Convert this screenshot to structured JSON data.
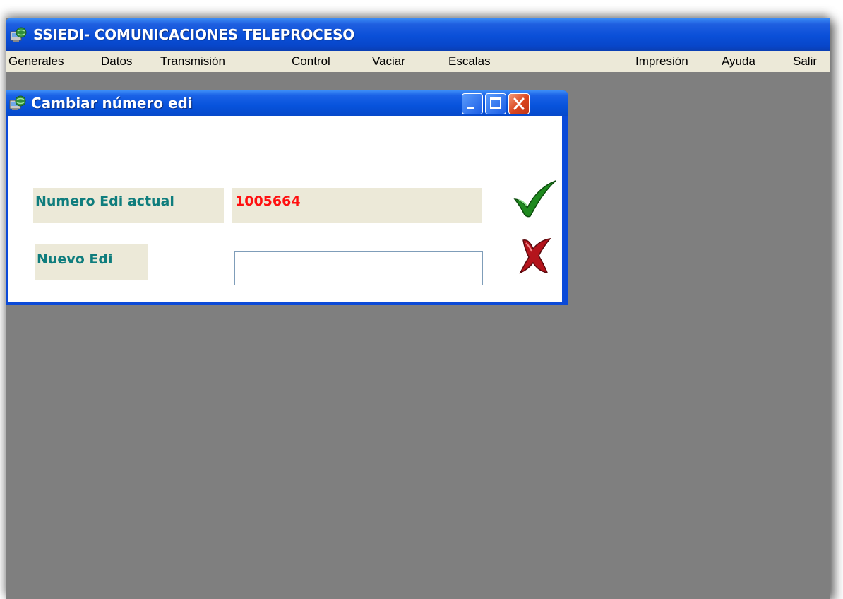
{
  "app": {
    "title": "SSIEDI- COMUNICACIONES TELEPROCESO",
    "icon": "app-icon"
  },
  "menu": {
    "items": [
      {
        "label": "Generales"
      },
      {
        "label": "Datos"
      },
      {
        "label": "Transmisión"
      },
      {
        "label": "Control"
      },
      {
        "label": "Vaciar"
      },
      {
        "label": "Escalas"
      },
      {
        "label": "Impresión"
      },
      {
        "label": "Ayuda"
      },
      {
        "label": "Salir"
      }
    ]
  },
  "dialog": {
    "title": "Cambiar número edi",
    "current_label": "Numero Edi actual",
    "current_value": "1005664",
    "new_label": "Nuevo Edi",
    "new_value": "",
    "accept_icon": "checkmark-icon",
    "cancel_icon": "red-x-icon"
  },
  "colors": {
    "titlebar_blue": "#0a4fd8",
    "label_teal": "#0f7d7d",
    "value_red": "#ff1010",
    "workspace_gray": "#7f7f7f",
    "label_bg": "#ece9d8"
  }
}
